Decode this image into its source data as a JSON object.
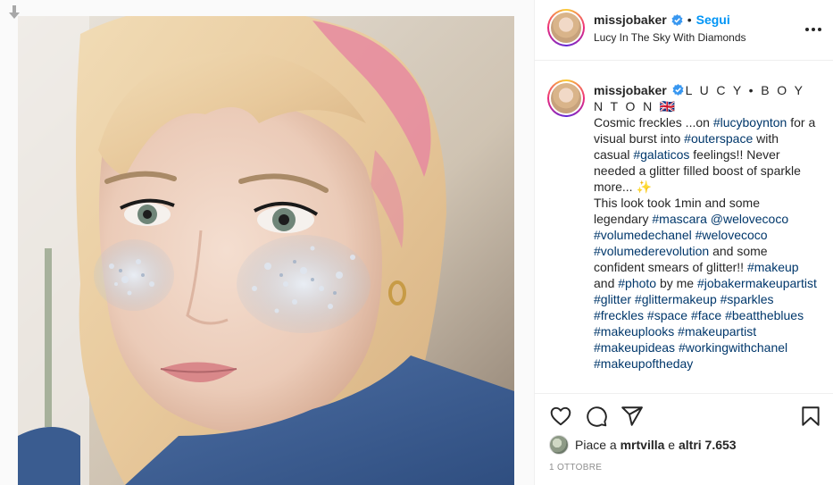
{
  "post": {
    "username": "missjobaker",
    "follow_label": "Segui",
    "dot": "•",
    "audio_title": "Lucy In The Sky With Diamonds"
  },
  "caption": {
    "username": "missjobaker",
    "name_text": "L U C Y • B O Y N T O N 🇬🇧",
    "segments": [
      {
        "t": "Cosmic freckles ...on ",
        "tag": false
      },
      {
        "t": "#lucyboynton",
        "tag": true
      },
      {
        "t": " for a visual burst into ",
        "tag": false
      },
      {
        "t": "#outerspace",
        "tag": true
      },
      {
        "t": " with casual ",
        "tag": false
      },
      {
        "t": "#galaticos",
        "tag": true
      },
      {
        "t": " feelings!! Never needed a glitter filled boost of sparkle more... ",
        "tag": false
      },
      {
        "t": "✨",
        "tag": false,
        "sparkle": true
      },
      {
        "t": "\n",
        "tag": false,
        "br": true
      },
      {
        "t": "This look took 1min and some legendary ",
        "tag": false
      },
      {
        "t": "#mascara",
        "tag": true
      },
      {
        "t": " ",
        "tag": false
      },
      {
        "t": "@welovecoco",
        "tag": true
      },
      {
        "t": " ",
        "tag": false
      },
      {
        "t": "#volumedechanel",
        "tag": true
      },
      {
        "t": " ",
        "tag": false
      },
      {
        "t": "#welovecoco",
        "tag": true
      },
      {
        "t": " ",
        "tag": false
      },
      {
        "t": "#volumederevolution",
        "tag": true
      },
      {
        "t": " and some confident smears of glitter!! ",
        "tag": false
      },
      {
        "t": "#makeup",
        "tag": true
      },
      {
        "t": " and ",
        "tag": false
      },
      {
        "t": "#photo",
        "tag": true
      },
      {
        "t": " by me ",
        "tag": false
      },
      {
        "t": "#jobakermakeupartist",
        "tag": true
      },
      {
        "t": " ",
        "tag": false
      },
      {
        "t": "#glitter",
        "tag": true
      },
      {
        "t": " ",
        "tag": false
      },
      {
        "t": "#glittermakeup",
        "tag": true
      },
      {
        "t": " ",
        "tag": false
      },
      {
        "t": "#sparkles",
        "tag": true
      },
      {
        "t": " ",
        "tag": false
      },
      {
        "t": "#freckles",
        "tag": true
      },
      {
        "t": " ",
        "tag": false
      },
      {
        "t": "#space",
        "tag": true
      },
      {
        "t": " ",
        "tag": false
      },
      {
        "t": "#face",
        "tag": true
      },
      {
        "t": " ",
        "tag": false
      },
      {
        "t": "#beattheblues",
        "tag": true
      },
      {
        "t": " ",
        "tag": false
      },
      {
        "t": "#makeuplooks",
        "tag": true
      },
      {
        "t": " ",
        "tag": false
      },
      {
        "t": "#makeupartist",
        "tag": true
      },
      {
        "t": " ",
        "tag": false
      },
      {
        "t": "#makeupideas",
        "tag": true
      },
      {
        "t": " ",
        "tag": false
      },
      {
        "t": "#workingwithchanel",
        "tag": true
      },
      {
        "t": " ",
        "tag": false
      },
      {
        "t": "#makeupoftheday",
        "tag": true
      }
    ]
  },
  "likes": {
    "prefix": "Piace a ",
    "user": "mrtvilla",
    "middle": " e ",
    "others": "altri 7.653"
  },
  "date": "1 ottobre",
  "icons": {
    "like": "heart-icon",
    "comment": "comment-icon",
    "share": "paper-plane-icon",
    "save": "bookmark-icon",
    "more": "more-options-icon",
    "verified": "verified-badge-icon",
    "download": "download-arrow-icon"
  },
  "colors": {
    "link": "#00376b",
    "follow": "#0095f6",
    "verified": "#3897f0",
    "muted": "#8e8e8e"
  }
}
